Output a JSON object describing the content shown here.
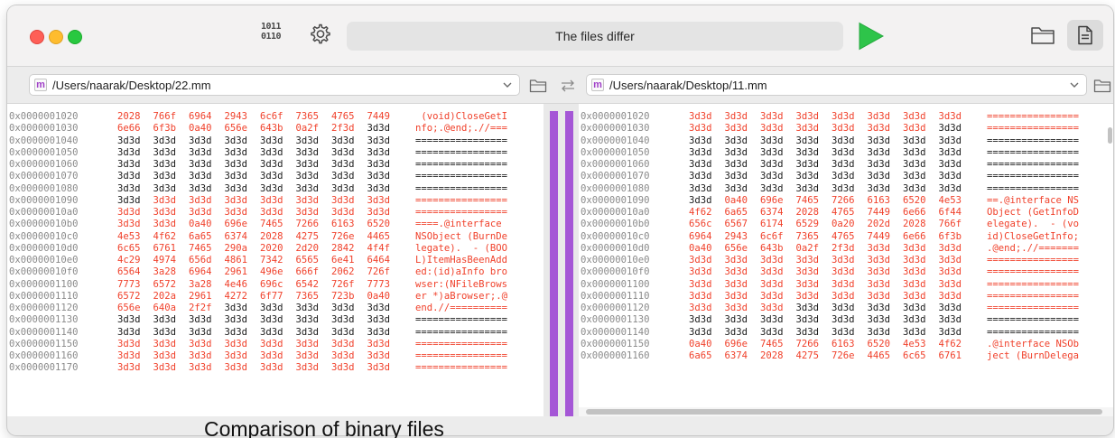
{
  "toolbar": {
    "binary_icon_text": "1011 0110",
    "status": "The files differ"
  },
  "left_file": {
    "path": "/Users/naarak/Desktop/22.mm",
    "badge": "m"
  },
  "right_file": {
    "path": "/Users/naarak/Desktop/11.mm",
    "badge": "m"
  },
  "colors": {
    "diff_text": "#f0412b",
    "diff_bar": "#a557d6",
    "run_green": "#2ec44a"
  },
  "left_rows": [
    {
      "addr": "0x0000001020",
      "hex": [
        "2028",
        "766f",
        "6964",
        "2943",
        "6c6f",
        "7365",
        "4765",
        "7449"
      ],
      "ascii": " (void)CloseGetI",
      "diff": [
        0,
        1,
        2,
        3,
        4,
        5,
        6,
        7
      ],
      "ascii_diff": true
    },
    {
      "addr": "0x0000001030",
      "hex": [
        "6e66",
        "6f3b",
        "0a40",
        "656e",
        "643b",
        "0a2f",
        "2f3d",
        "3d3d"
      ],
      "ascii": "nfo;.@end;.//===",
      "diff": [
        0,
        1,
        2,
        3,
        4,
        5,
        6
      ],
      "ascii_diff": true
    },
    {
      "addr": "0x0000001040",
      "hex": [
        "3d3d",
        "3d3d",
        "3d3d",
        "3d3d",
        "3d3d",
        "3d3d",
        "3d3d",
        "3d3d"
      ],
      "ascii": "================",
      "diff": [],
      "ascii_diff": false
    },
    {
      "addr": "0x0000001050",
      "hex": [
        "3d3d",
        "3d3d",
        "3d3d",
        "3d3d",
        "3d3d",
        "3d3d",
        "3d3d",
        "3d3d"
      ],
      "ascii": "================",
      "diff": [],
      "ascii_diff": false
    },
    {
      "addr": "0x0000001060",
      "hex": [
        "3d3d",
        "3d3d",
        "3d3d",
        "3d3d",
        "3d3d",
        "3d3d",
        "3d3d",
        "3d3d"
      ],
      "ascii": "================",
      "diff": [],
      "ascii_diff": false
    },
    {
      "addr": "0x0000001070",
      "hex": [
        "3d3d",
        "3d3d",
        "3d3d",
        "3d3d",
        "3d3d",
        "3d3d",
        "3d3d",
        "3d3d"
      ],
      "ascii": "================",
      "diff": [],
      "ascii_diff": false
    },
    {
      "addr": "0x0000001080",
      "hex": [
        "3d3d",
        "3d3d",
        "3d3d",
        "3d3d",
        "3d3d",
        "3d3d",
        "3d3d",
        "3d3d"
      ],
      "ascii": "================",
      "diff": [],
      "ascii_diff": false
    },
    {
      "addr": "0x0000001090",
      "hex": [
        "3d3d",
        "3d3d",
        "3d3d",
        "3d3d",
        "3d3d",
        "3d3d",
        "3d3d",
        "3d3d"
      ],
      "ascii": "================",
      "diff": [
        1,
        2,
        3,
        4,
        5,
        6,
        7
      ],
      "ascii_diff": true
    },
    {
      "addr": "0x00000010a0",
      "hex": [
        "3d3d",
        "3d3d",
        "3d3d",
        "3d3d",
        "3d3d",
        "3d3d",
        "3d3d",
        "3d3d"
      ],
      "ascii": "================",
      "diff": [
        0,
        1,
        2,
        3,
        4,
        5,
        6,
        7
      ],
      "ascii_diff": true
    },
    {
      "addr": "0x00000010b0",
      "hex": [
        "3d3d",
        "3d3d",
        "0a40",
        "696e",
        "7465",
        "7266",
        "6163",
        "6520"
      ],
      "ascii": "====.@interface ",
      "diff": [
        0,
        1,
        2,
        3,
        4,
        5,
        6,
        7
      ],
      "ascii_diff": true
    },
    {
      "addr": "0x00000010c0",
      "hex": [
        "4e53",
        "4f62",
        "6a65",
        "6374",
        "2028",
        "4275",
        "726e",
        "4465"
      ],
      "ascii": "NSObject (BurnDe",
      "diff": [
        0,
        1,
        2,
        3,
        4,
        5,
        6,
        7
      ],
      "ascii_diff": true
    },
    {
      "addr": "0x00000010d0",
      "hex": [
        "6c65",
        "6761",
        "7465",
        "290a",
        "2020",
        "2d20",
        "2842",
        "4f4f"
      ],
      "ascii": "legate).  - (BOO",
      "diff": [
        0,
        1,
        2,
        3,
        4,
        5,
        6,
        7
      ],
      "ascii_diff": true
    },
    {
      "addr": "0x00000010e0",
      "hex": [
        "4c29",
        "4974",
        "656d",
        "4861",
        "7342",
        "6565",
        "6e41",
        "6464"
      ],
      "ascii": "L)ItemHasBeenAdd",
      "diff": [
        0,
        1,
        2,
        3,
        4,
        5,
        6,
        7
      ],
      "ascii_diff": true
    },
    {
      "addr": "0x00000010f0",
      "hex": [
        "6564",
        "3a28",
        "6964",
        "2961",
        "496e",
        "666f",
        "2062",
        "726f"
      ],
      "ascii": "ed:(id)aInfo bro",
      "diff": [
        0,
        1,
        2,
        3,
        4,
        5,
        6,
        7
      ],
      "ascii_diff": true
    },
    {
      "addr": "0x0000001100",
      "hex": [
        "7773",
        "6572",
        "3a28",
        "4e46",
        "696c",
        "6542",
        "726f",
        "7773"
      ],
      "ascii": "wser:(NFileBrows",
      "diff": [
        0,
        1,
        2,
        3,
        4,
        5,
        6,
        7
      ],
      "ascii_diff": true
    },
    {
      "addr": "0x0000001110",
      "hex": [
        "6572",
        "202a",
        "2961",
        "4272",
        "6f77",
        "7365",
        "723b",
        "0a40"
      ],
      "ascii": "er *)aBrowser;.@",
      "diff": [
        0,
        1,
        2,
        3,
        4,
        5,
        6,
        7
      ],
      "ascii_diff": true
    },
    {
      "addr": "0x0000001120",
      "hex": [
        "656e",
        "640a",
        "2f2f",
        "3d3d",
        "3d3d",
        "3d3d",
        "3d3d",
        "3d3d"
      ],
      "ascii": "end.//==========",
      "diff": [
        0,
        1,
        2
      ],
      "ascii_diff": true
    },
    {
      "addr": "0x0000001130",
      "hex": [
        "3d3d",
        "3d3d",
        "3d3d",
        "3d3d",
        "3d3d",
        "3d3d",
        "3d3d",
        "3d3d"
      ],
      "ascii": "================",
      "diff": [],
      "ascii_diff": false
    },
    {
      "addr": "0x0000001140",
      "hex": [
        "3d3d",
        "3d3d",
        "3d3d",
        "3d3d",
        "3d3d",
        "3d3d",
        "3d3d",
        "3d3d"
      ],
      "ascii": "================",
      "diff": [],
      "ascii_diff": false
    },
    {
      "addr": "0x0000001150",
      "hex": [
        "3d3d",
        "3d3d",
        "3d3d",
        "3d3d",
        "3d3d",
        "3d3d",
        "3d3d",
        "3d3d"
      ],
      "ascii": "================",
      "diff": [
        0,
        1,
        2,
        3,
        4,
        5,
        6,
        7
      ],
      "ascii_diff": true
    },
    {
      "addr": "0x0000001160",
      "hex": [
        "3d3d",
        "3d3d",
        "3d3d",
        "3d3d",
        "3d3d",
        "3d3d",
        "3d3d",
        "3d3d"
      ],
      "ascii": "================",
      "diff": [
        0,
        1,
        2,
        3,
        4,
        5,
        6,
        7
      ],
      "ascii_diff": true
    },
    {
      "addr": "0x0000001170",
      "hex": [
        "3d3d",
        "3d3d",
        "3d3d",
        "3d3d",
        "3d3d",
        "3d3d",
        "3d3d",
        "3d3d"
      ],
      "ascii": "================",
      "diff": [
        0,
        1,
        2,
        3,
        4,
        5,
        6,
        7
      ],
      "ascii_diff": true
    }
  ],
  "right_rows": [
    {
      "addr": "0x0000001020",
      "hex": [
        "3d3d",
        "3d3d",
        "3d3d",
        "3d3d",
        "3d3d",
        "3d3d",
        "3d3d",
        "3d3d"
      ],
      "ascii": "================",
      "diff": [
        0,
        1,
        2,
        3,
        4,
        5,
        6,
        7
      ],
      "ascii_diff": true
    },
    {
      "addr": "0x0000001030",
      "hex": [
        "3d3d",
        "3d3d",
        "3d3d",
        "3d3d",
        "3d3d",
        "3d3d",
        "3d3d",
        "3d3d"
      ],
      "ascii": "================",
      "diff": [
        0,
        1,
        2,
        3,
        4,
        5,
        6
      ],
      "ascii_diff": true
    },
    {
      "addr": "0x0000001040",
      "hex": [
        "3d3d",
        "3d3d",
        "3d3d",
        "3d3d",
        "3d3d",
        "3d3d",
        "3d3d",
        "3d3d"
      ],
      "ascii": "================",
      "diff": [],
      "ascii_diff": false
    },
    {
      "addr": "0x0000001050",
      "hex": [
        "3d3d",
        "3d3d",
        "3d3d",
        "3d3d",
        "3d3d",
        "3d3d",
        "3d3d",
        "3d3d"
      ],
      "ascii": "================",
      "diff": [],
      "ascii_diff": false
    },
    {
      "addr": "0x0000001060",
      "hex": [
        "3d3d",
        "3d3d",
        "3d3d",
        "3d3d",
        "3d3d",
        "3d3d",
        "3d3d",
        "3d3d"
      ],
      "ascii": "================",
      "diff": [],
      "ascii_diff": false
    },
    {
      "addr": "0x0000001070",
      "hex": [
        "3d3d",
        "3d3d",
        "3d3d",
        "3d3d",
        "3d3d",
        "3d3d",
        "3d3d",
        "3d3d"
      ],
      "ascii": "================",
      "diff": [],
      "ascii_diff": false
    },
    {
      "addr": "0x0000001080",
      "hex": [
        "3d3d",
        "3d3d",
        "3d3d",
        "3d3d",
        "3d3d",
        "3d3d",
        "3d3d",
        "3d3d"
      ],
      "ascii": "================",
      "diff": [],
      "ascii_diff": false
    },
    {
      "addr": "0x0000001090",
      "hex": [
        "3d3d",
        "0a40",
        "696e",
        "7465",
        "7266",
        "6163",
        "6520",
        "4e53"
      ],
      "ascii": "==.@interface NS",
      "diff": [
        1,
        2,
        3,
        4,
        5,
        6,
        7
      ],
      "ascii_diff": true
    },
    {
      "addr": "0x00000010a0",
      "hex": [
        "4f62",
        "6a65",
        "6374",
        "2028",
        "4765",
        "7449",
        "6e66",
        "6f44"
      ],
      "ascii": "Object (GetInfoD",
      "diff": [
        0,
        1,
        2,
        3,
        4,
        5,
        6,
        7
      ],
      "ascii_diff": true
    },
    {
      "addr": "0x00000010b0",
      "hex": [
        "656c",
        "6567",
        "6174",
        "6529",
        "0a20",
        "202d",
        "2028",
        "766f"
      ],
      "ascii": "elegate).  - (vo",
      "diff": [
        0,
        1,
        2,
        3,
        4,
        5,
        6,
        7
      ],
      "ascii_diff": true
    },
    {
      "addr": "0x00000010c0",
      "hex": [
        "6964",
        "2943",
        "6c6f",
        "7365",
        "4765",
        "7449",
        "6e66",
        "6f3b"
      ],
      "ascii": "id)CloseGetInfo;",
      "diff": [
        0,
        1,
        2,
        3,
        4,
        5,
        6,
        7
      ],
      "ascii_diff": true
    },
    {
      "addr": "0x00000010d0",
      "hex": [
        "0a40",
        "656e",
        "643b",
        "0a2f",
        "2f3d",
        "3d3d",
        "3d3d",
        "3d3d"
      ],
      "ascii": ".@end;.//=======",
      "diff": [
        0,
        1,
        2,
        3,
        4,
        5,
        6,
        7
      ],
      "ascii_diff": true
    },
    {
      "addr": "0x00000010e0",
      "hex": [
        "3d3d",
        "3d3d",
        "3d3d",
        "3d3d",
        "3d3d",
        "3d3d",
        "3d3d",
        "3d3d"
      ],
      "ascii": "================",
      "diff": [
        0,
        1,
        2,
        3,
        4,
        5,
        6,
        7
      ],
      "ascii_diff": true
    },
    {
      "addr": "0x00000010f0",
      "hex": [
        "3d3d",
        "3d3d",
        "3d3d",
        "3d3d",
        "3d3d",
        "3d3d",
        "3d3d",
        "3d3d"
      ],
      "ascii": "================",
      "diff": [
        0,
        1,
        2,
        3,
        4,
        5,
        6,
        7
      ],
      "ascii_diff": true
    },
    {
      "addr": "0x0000001100",
      "hex": [
        "3d3d",
        "3d3d",
        "3d3d",
        "3d3d",
        "3d3d",
        "3d3d",
        "3d3d",
        "3d3d"
      ],
      "ascii": "================",
      "diff": [
        0,
        1,
        2,
        3,
        4,
        5,
        6,
        7
      ],
      "ascii_diff": true
    },
    {
      "addr": "0x0000001110",
      "hex": [
        "3d3d",
        "3d3d",
        "3d3d",
        "3d3d",
        "3d3d",
        "3d3d",
        "3d3d",
        "3d3d"
      ],
      "ascii": "================",
      "diff": [
        0,
        1,
        2,
        3,
        4,
        5,
        6,
        7
      ],
      "ascii_diff": true
    },
    {
      "addr": "0x0000001120",
      "hex": [
        "3d3d",
        "3d3d",
        "3d3d",
        "3d3d",
        "3d3d",
        "3d3d",
        "3d3d",
        "3d3d"
      ],
      "ascii": "================",
      "diff": [
        0,
        1,
        2
      ],
      "ascii_diff": true
    },
    {
      "addr": "0x0000001130",
      "hex": [
        "3d3d",
        "3d3d",
        "3d3d",
        "3d3d",
        "3d3d",
        "3d3d",
        "3d3d",
        "3d3d"
      ],
      "ascii": "================",
      "diff": [],
      "ascii_diff": false
    },
    {
      "addr": "0x0000001140",
      "hex": [
        "3d3d",
        "3d3d",
        "3d3d",
        "3d3d",
        "3d3d",
        "3d3d",
        "3d3d",
        "3d3d"
      ],
      "ascii": "================",
      "diff": [],
      "ascii_diff": false
    },
    {
      "addr": "0x0000001150",
      "hex": [
        "0a40",
        "696e",
        "7465",
        "7266",
        "6163",
        "6520",
        "4e53",
        "4f62"
      ],
      "ascii": ".@interface NSOb",
      "diff": [
        0,
        1,
        2,
        3,
        4,
        5,
        6,
        7
      ],
      "ascii_diff": true
    },
    {
      "addr": "0x0000001160",
      "hex": [
        "6a65",
        "6374",
        "2028",
        "4275",
        "726e",
        "4465",
        "6c65",
        "6761"
      ],
      "ascii": "ject (BurnDelega",
      "diff": [
        0,
        1,
        2,
        3,
        4,
        5,
        6,
        7
      ],
      "ascii_diff": true
    }
  ],
  "caption": "Comparison of binary files"
}
